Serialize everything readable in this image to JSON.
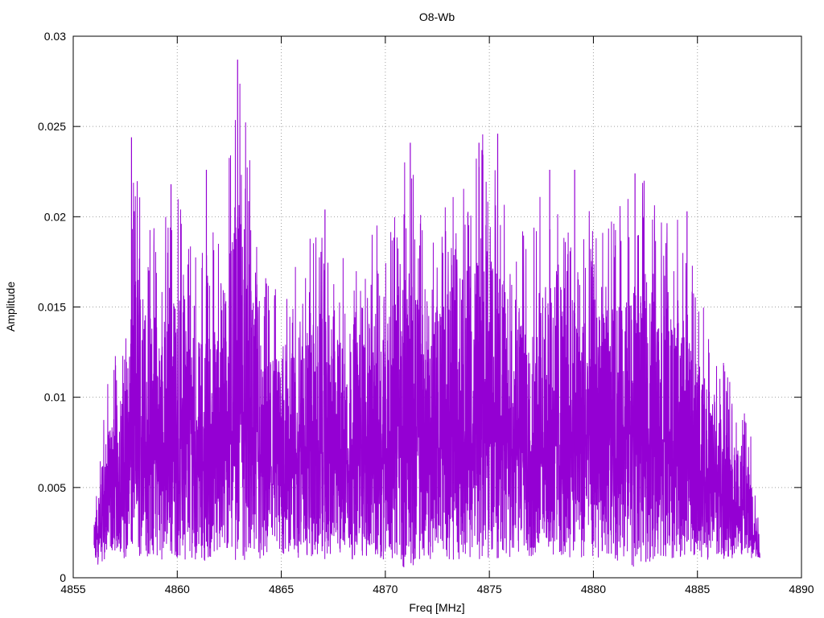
{
  "chart_data": {
    "type": "line",
    "title": "O8-Wb",
    "xlabel": "Freq [MHz]",
    "ylabel": "Amplitude",
    "xlim": [
      4855,
      4890
    ],
    "ylim": [
      0,
      0.03
    ],
    "x_ticks": [
      "4855",
      "4860",
      "4865",
      "4870",
      "4875",
      "4880",
      "4885",
      "4890"
    ],
    "y_ticks": [
      "0",
      "0.005",
      "0.01",
      "0.015",
      "0.02",
      "0.025",
      "0.03"
    ],
    "grid": true,
    "series": [
      {
        "color": "#9400d3",
        "x_range": [
          4856.0,
          4888.0
        ],
        "description_points": {
          "x": [
            4856.0,
            4856.5,
            4857.0,
            4857.5,
            4858.0,
            4859.0,
            4860.0,
            4861.0,
            4862.0,
            4863.0,
            4864.0,
            4865.0,
            4866.0,
            4867.0,
            4868.0,
            4869.0,
            4870.0,
            4871.0,
            4872.0,
            4873.0,
            4874.0,
            4875.0,
            4876.0,
            4877.0,
            4878.0,
            4879.0,
            4880.0,
            4881.0,
            4882.0,
            4883.0,
            4884.0,
            4885.0,
            4886.0,
            4887.0,
            4887.5,
            4888.0
          ],
          "envelope_max": [
            0.004,
            0.01,
            0.013,
            0.015,
            0.024,
            0.019,
            0.022,
            0.018,
            0.02,
            0.029,
            0.017,
            0.016,
            0.019,
            0.02,
            0.018,
            0.019,
            0.02,
            0.024,
            0.02,
            0.022,
            0.024,
            0.025,
            0.022,
            0.02,
            0.023,
            0.022,
            0.02,
            0.021,
            0.022,
            0.022,
            0.02,
            0.017,
            0.013,
            0.01,
            0.009,
            0.003
          ],
          "envelope_min": [
            0.0005,
            0.001,
            0.0015,
            0.001,
            0.001,
            0.001,
            0.001,
            0.001,
            0.0008,
            0.001,
            0.0005,
            0.001,
            0.001,
            0.001,
            0.001,
            0.001,
            0.001,
            0.0005,
            0.001,
            0.001,
            0.001,
            0.001,
            0.001,
            0.001,
            0.001,
            0.001,
            0.001,
            0.001,
            0.0005,
            0.001,
            0.001,
            0.001,
            0.001,
            0.001,
            0.001,
            0.001
          ]
        },
        "peaks": [
          {
            "x": 4857.8,
            "y": 0.0244
          },
          {
            "x": 4859.7,
            "y": 0.0218
          },
          {
            "x": 4861.4,
            "y": 0.0226
          },
          {
            "x": 4862.9,
            "y": 0.0287
          },
          {
            "x": 4867.1,
            "y": 0.0204
          },
          {
            "x": 4871.2,
            "y": 0.0241
          },
          {
            "x": 4874.5,
            "y": 0.0241
          },
          {
            "x": 4875.4,
            "y": 0.0246
          },
          {
            "x": 4877.9,
            "y": 0.0226
          },
          {
            "x": 4879.1,
            "y": 0.0226
          },
          {
            "x": 4882.0,
            "y": 0.0224
          },
          {
            "x": 4884.5,
            "y": 0.0203
          }
        ]
      }
    ]
  }
}
